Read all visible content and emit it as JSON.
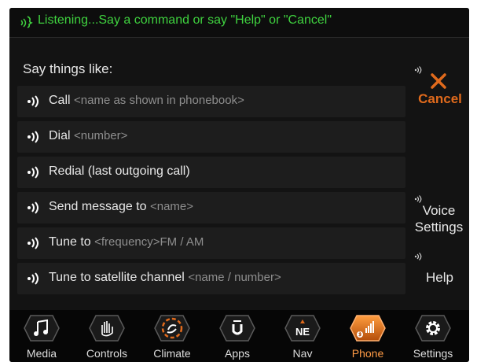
{
  "header": {
    "listening_text": "Listening...Say a command or say \"Help\" or \"Cancel\""
  },
  "prompt_title": "Say things like:",
  "commands": [
    {
      "main": "Call",
      "hint": "<name as shown in phonebook>"
    },
    {
      "main": "Dial",
      "hint": "<number>"
    },
    {
      "main": "Redial (last outgoing call)",
      "hint": ""
    },
    {
      "main": "Send message to",
      "hint": "<name>"
    },
    {
      "main": "Tune to",
      "hint": "<frequency>FM / AM"
    },
    {
      "main": "Tune to satellite channel",
      "hint": "<name / number>"
    }
  ],
  "side": {
    "cancel_label": "Cancel",
    "voice_settings_line1": "Voice",
    "voice_settings_line2": "Settings",
    "help_label": "Help"
  },
  "nav": [
    {
      "label": "Media",
      "icon": "music-note-icon"
    },
    {
      "label": "Controls",
      "icon": "hand-controls-icon"
    },
    {
      "label": "Climate",
      "icon": "climate-fan-icon"
    },
    {
      "label": "Apps",
      "icon": "uconnect-apps-icon"
    },
    {
      "label": "Nav",
      "icon": "compass-ne-icon",
      "badge": "NE"
    },
    {
      "label": "Phone",
      "icon": "phone-signal-icon",
      "active": true
    },
    {
      "label": "Settings",
      "icon": "gear-icon"
    }
  ],
  "colors": {
    "accent_green": "#3fd23f",
    "accent_orange": "#e06a1c",
    "background": "#131313"
  }
}
